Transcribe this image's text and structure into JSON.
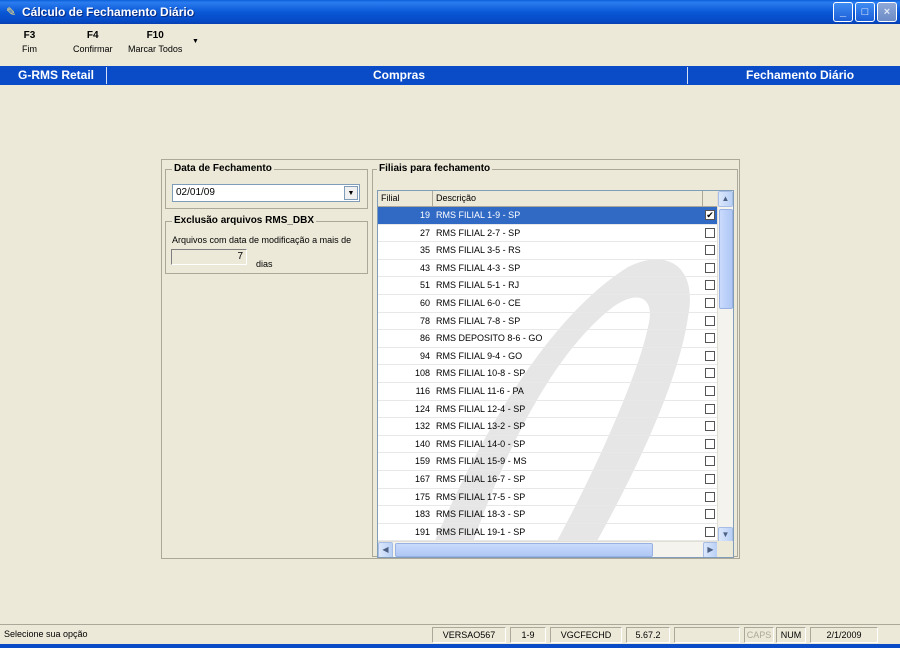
{
  "window": {
    "title": "Cálculo de Fechamento Diário",
    "app_icon": "rms-app-icon",
    "buttons": {
      "minimize": "_",
      "maximize": "□",
      "close": "×"
    }
  },
  "toolbar": {
    "items": [
      {
        "key": "F3",
        "label": "Fim"
      },
      {
        "key": "F4",
        "label": "Confirmar"
      },
      {
        "key": "F10",
        "label": "Marcar Todos"
      }
    ],
    "more_arrow": "▼"
  },
  "header": {
    "left": "G-RMS Retail",
    "center": "Compras",
    "right": "Fechamento Diário"
  },
  "data_fechamento": {
    "legend": "Data de Fechamento",
    "value": "02/01/09",
    "arrow": "▼"
  },
  "exclusao": {
    "legend": "Exclusão arquivos RMS_DBX",
    "label": "Arquivos com data de modificação a mais de",
    "days": "7",
    "unit": "dias"
  },
  "filiais": {
    "legend": "Filiais para fechamento",
    "columns": {
      "filial": "Filial",
      "descricao": "Descrição"
    },
    "rows": [
      {
        "filial": "19",
        "descricao": "RMS FILIAL 1-9 - SP",
        "checked": true,
        "selected": true
      },
      {
        "filial": "27",
        "descricao": "RMS FILIAL 2-7 - SP",
        "checked": false
      },
      {
        "filial": "35",
        "descricao": "RMS FILIAL 3-5 - RS",
        "checked": false
      },
      {
        "filial": "43",
        "descricao": "RMS FILIAL 4-3 - SP",
        "checked": false
      },
      {
        "filial": "51",
        "descricao": "RMS FILIAL 5-1 - RJ",
        "checked": false
      },
      {
        "filial": "60",
        "descricao": "RMS FILIAL 6-0 - CE",
        "checked": false
      },
      {
        "filial": "78",
        "descricao": "RMS FILIAL 7-8 - SP",
        "checked": false
      },
      {
        "filial": "86",
        "descricao": "RMS DEPOSITO 8-6 - GO",
        "checked": false
      },
      {
        "filial": "94",
        "descricao": "RMS FILIAL 9-4 - GO",
        "checked": false
      },
      {
        "filial": "108",
        "descricao": "RMS FILIAL 10-8 - SP",
        "checked": false
      },
      {
        "filial": "116",
        "descricao": "RMS FILIAL 11-6 - PA",
        "checked": false
      },
      {
        "filial": "124",
        "descricao": "RMS FILIAL 12-4 - SP",
        "checked": false
      },
      {
        "filial": "132",
        "descricao": "RMS FILIAL 13-2 - SP",
        "checked": false
      },
      {
        "filial": "140",
        "descricao": "RMS FILIAL 14-0 - SP",
        "checked": false
      },
      {
        "filial": "159",
        "descricao": "RMS FILIAL 15-9 - MS",
        "checked": false
      },
      {
        "filial": "167",
        "descricao": "RMS FILIAL 16-7 - SP",
        "checked": false
      },
      {
        "filial": "175",
        "descricao": "RMS FILIAL 17-5 - SP",
        "checked": false
      },
      {
        "filial": "183",
        "descricao": "RMS FILIAL 18-3 - SP",
        "checked": false
      },
      {
        "filial": "191",
        "descricao": "RMS FILIAL 19-1 - SP",
        "checked": false
      }
    ],
    "scroll": {
      "up": "▲",
      "down": "▼",
      "left": "◀",
      "right": "▶"
    }
  },
  "status": {
    "message": "Selecione sua opção",
    "version": "VERSAO567",
    "filial": "1-9",
    "program": "VGCFECHD",
    "release": "5.67.2",
    "caps": "CAPS",
    "num": "NUM",
    "date": "2/1/2009"
  },
  "colors": {
    "titlebar": "#0a58d6",
    "header": "#0a4cc8",
    "selection": "#316ac5",
    "face": "#ece9d8"
  }
}
